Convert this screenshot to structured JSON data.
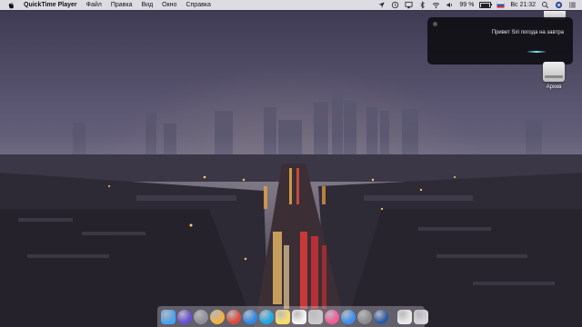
{
  "menubar": {
    "app_name": "QuickTime Player",
    "menus": [
      "Файл",
      "Правка",
      "Вид",
      "Окно",
      "Справка"
    ],
    "battery_percent": "99 %",
    "clock": "Вс 21:32",
    "battery_level": 0.99
  },
  "siri_notification": {
    "text": "Привет Siri погода на завтра"
  },
  "desktop": {
    "drive_label": "Архив"
  },
  "dock": {
    "items": [
      {
        "name": "finder-icon",
        "color": "#4aa3f0"
      },
      {
        "name": "siri-icon",
        "color": "#6a4fd8"
      },
      {
        "name": "launchpad-icon",
        "color": "#8f8f99"
      },
      {
        "name": "photos-icon",
        "color": "#f0b342"
      },
      {
        "name": "chrome-icon",
        "color": "#e04a3a"
      },
      {
        "name": "safari-icon",
        "color": "#2d8ae8"
      },
      {
        "name": "skype-icon",
        "color": "#19a9ea"
      },
      {
        "name": "notes-icon",
        "color": "#f7dd6a"
      },
      {
        "name": "textedit-icon",
        "color": "#f4f4f4"
      },
      {
        "name": "preview-icon",
        "color": "#c9c9c9"
      },
      {
        "name": "itunes-icon",
        "color": "#f25a9a"
      },
      {
        "name": "app-store-icon",
        "color": "#3a8ff0"
      },
      {
        "name": "system-preferences-icon",
        "color": "#8c8c8c"
      },
      {
        "name": "quicktime-icon",
        "color": "#2a5aa8"
      }
    ],
    "trailing": [
      {
        "name": "document-icon",
        "color": "#e9e9e9"
      },
      {
        "name": "trash-icon",
        "color": "#d6d6d6"
      }
    ]
  }
}
